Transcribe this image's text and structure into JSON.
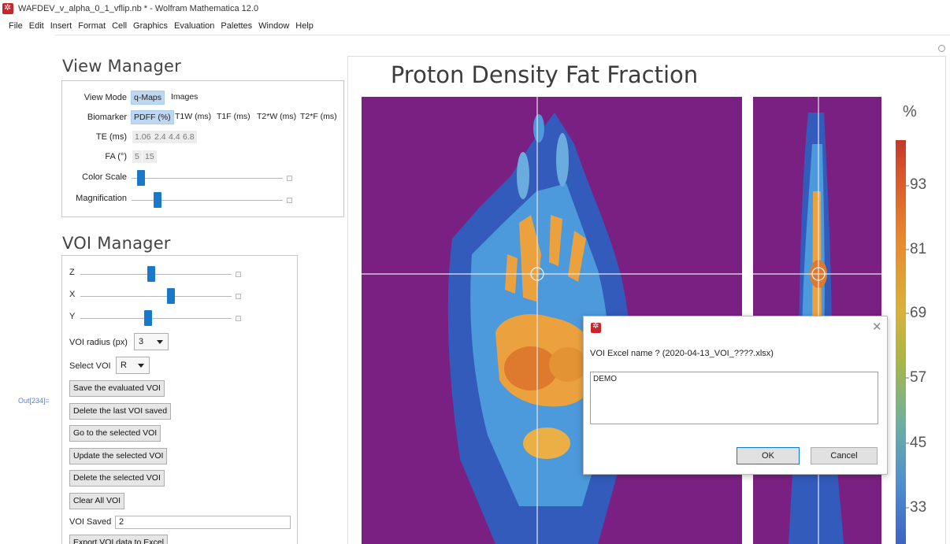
{
  "window": {
    "title": "WAFDEV_v_alpha_0_1_vflip.nb * - Wolfram Mathematica 12.0",
    "menu": [
      "File",
      "Edit",
      "Insert",
      "Format",
      "Cell",
      "Graphics",
      "Evaluation",
      "Palettes",
      "Window",
      "Help"
    ]
  },
  "out_label": "Out[234]=",
  "view_manager": {
    "heading": "View Manager",
    "view_mode": {
      "label": "View Mode",
      "options": [
        "q-Maps",
        "Images"
      ],
      "selected": "q-Maps"
    },
    "biomarker": {
      "label": "Biomarker",
      "options": [
        "PDFF (%)",
        "T1W (ms)",
        "T1F (ms)",
        "T2*W (ms)",
        "T2*F (ms)"
      ],
      "selected": "PDFF (%)"
    },
    "te": {
      "label": "TE (ms)",
      "options": [
        "1.06",
        "2.4",
        "4.4",
        "6.8"
      ]
    },
    "fa": {
      "label": "FA (°)",
      "options": [
        "5",
        "15"
      ]
    },
    "color_scale": {
      "label": "Color Scale",
      "level": 0.06
    },
    "magnification": {
      "label": "Magnification",
      "level": 0.17
    }
  },
  "voi_manager": {
    "heading": "VOI Manager",
    "z": {
      "label": "Z",
      "level": 0.47
    },
    "x": {
      "label": "X",
      "level": 0.6
    },
    "y": {
      "label": "Y",
      "level": 0.45
    },
    "voi_radius": {
      "label": "VOI radius (px)",
      "value": "3"
    },
    "select_voi": {
      "label": "Select VOI",
      "value": "R"
    },
    "buttons": {
      "save": "Save the evaluated VOI",
      "delete_last": "Delete the last VOI saved",
      "goto": "Go to the selected VOI",
      "update": "Update the selected VOI",
      "delete_selected": "Delete the selected VOI",
      "clear_all": "Clear All VOI",
      "export": "Export VOI data to Excel"
    },
    "voi_saved": {
      "label": "VOI Saved",
      "value": "2"
    }
  },
  "plot": {
    "title": "Proton Density Fat Fraction",
    "colorbar_unit": "%",
    "colorbar_ticks": [
      "93",
      "81",
      "69",
      "57",
      "45",
      "33"
    ],
    "background_color": "#7b2083"
  },
  "dialog": {
    "prompt": "VOI Excel name ? (2020-04-13_VOI_????.xlsx)",
    "input_value": "DEMO",
    "ok": "OK",
    "cancel": "Cancel"
  }
}
